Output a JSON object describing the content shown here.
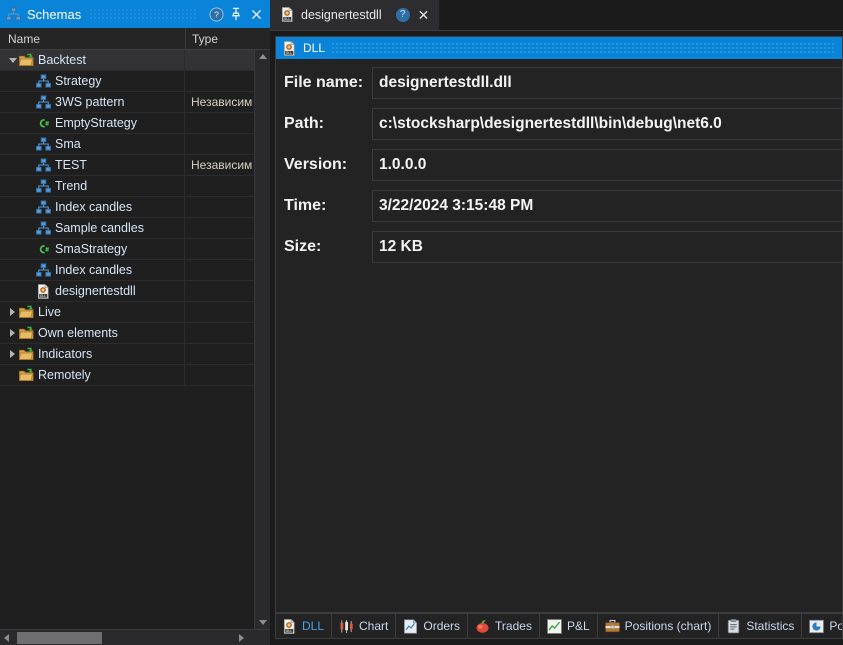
{
  "left_panel": {
    "title": "Schemas",
    "title_icon": "schema-icon",
    "buttons": {
      "help": "?",
      "pin": "pin-icon",
      "close": "close-icon"
    },
    "columns": {
      "name": "Name",
      "type": "Type"
    },
    "rows": [
      {
        "label": "Backtest",
        "type": "",
        "icon": "folder-icon",
        "indent": 0,
        "expander": "down",
        "selected": true
      },
      {
        "label": "Strategy",
        "type": "",
        "icon": "schema-icon",
        "indent": 1,
        "expander": "none",
        "selected": false
      },
      {
        "label": "3WS pattern",
        "type": "Независим",
        "icon": "schema-icon",
        "indent": 1,
        "expander": "none",
        "selected": false
      },
      {
        "label": "EmptyStrategy",
        "type": "",
        "icon": "csharp-icon",
        "indent": 1,
        "expander": "none",
        "selected": false
      },
      {
        "label": "Sma",
        "type": "",
        "icon": "schema-icon",
        "indent": 1,
        "expander": "none",
        "selected": false
      },
      {
        "label": "TEST",
        "type": "Независим",
        "icon": "schema-icon",
        "indent": 1,
        "expander": "none",
        "selected": false
      },
      {
        "label": "Trend",
        "type": "",
        "icon": "schema-icon",
        "indent": 1,
        "expander": "none",
        "selected": false
      },
      {
        "label": "Index candles",
        "type": "",
        "icon": "schema-icon",
        "indent": 1,
        "expander": "none",
        "selected": false
      },
      {
        "label": "Sample candles",
        "type": "",
        "icon": "schema-icon",
        "indent": 1,
        "expander": "none",
        "selected": false
      },
      {
        "label": "SmaStrategy",
        "type": "",
        "icon": "csharp-icon",
        "indent": 1,
        "expander": "none",
        "selected": false
      },
      {
        "label": "Index candles",
        "type": "",
        "icon": "schema-icon",
        "indent": 1,
        "expander": "none",
        "selected": false
      },
      {
        "label": "designertestdll",
        "type": "",
        "icon": "dll-icon",
        "indent": 1,
        "expander": "none",
        "selected": false
      },
      {
        "label": "Live",
        "type": "",
        "icon": "folder-icon",
        "indent": 0,
        "expander": "right",
        "selected": false
      },
      {
        "label": "Own elements",
        "type": "",
        "icon": "folder-icon",
        "indent": 0,
        "expander": "right",
        "selected": false
      },
      {
        "label": "Indicators",
        "type": "",
        "icon": "folder-icon",
        "indent": 0,
        "expander": "right",
        "selected": false
      },
      {
        "label": "Remotely",
        "type": "",
        "icon": "folder-icon",
        "indent": 0,
        "expander": "none",
        "selected": false
      }
    ]
  },
  "document_tab": {
    "label": "designertestdll",
    "icon": "dll-icon",
    "help_glyph": "?",
    "close_glyph": "✕"
  },
  "dll_panel": {
    "header": "DLL",
    "header_icon": "dll-icon",
    "fields": [
      {
        "label": "File name:",
        "value": "designertestdll.dll"
      },
      {
        "label": "Path:",
        "value": "c:\\stocksharp\\designertestdll\\bin\\debug\\net6.0"
      },
      {
        "label": "Version:",
        "value": "1.0.0.0"
      },
      {
        "label": "Time:",
        "value": "3/22/2024 3:15:48 PM"
      },
      {
        "label": "Size:",
        "value": "12 KB"
      }
    ]
  },
  "bottom_tabs": [
    {
      "label": "DLL",
      "icon": "dll-icon",
      "active": true
    },
    {
      "label": "Chart",
      "icon": "candles-icon",
      "active": false
    },
    {
      "label": "Orders",
      "icon": "orders-icon",
      "active": false
    },
    {
      "label": "Trades",
      "icon": "trades-icon",
      "active": false
    },
    {
      "label": "P&L",
      "icon": "pnl-icon",
      "active": false
    },
    {
      "label": "Positions (chart)",
      "icon": "briefcase-icon",
      "active": false
    },
    {
      "label": "Statistics",
      "icon": "clipboard-icon",
      "active": false
    },
    {
      "label": "Positions",
      "icon": "piechart-icon",
      "active": false
    }
  ],
  "colors": {
    "accent": "#0a84d8",
    "panel_bg": "#232324",
    "tree_bg": "#1f1f20",
    "text": "#d6e6f5",
    "selected_row": "#333336"
  }
}
